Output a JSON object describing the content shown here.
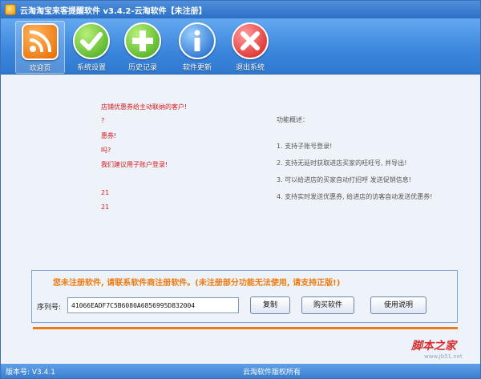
{
  "window": {
    "title": "云淘淘宝来客提醒软件 v3.4.2-云淘软件【未注册】"
  },
  "toolbar": {
    "items": [
      {
        "label": "欢迎页",
        "icon": "rss-icon",
        "active": true
      },
      {
        "label": "系统设置",
        "icon": "checkmark-icon"
      },
      {
        "label": "历史记录",
        "icon": "plus-icon"
      },
      {
        "label": "软件更新",
        "icon": "info-icon"
      },
      {
        "label": "退出系统",
        "icon": "close-icon"
      }
    ]
  },
  "log": {
    "lines": [
      "店铺优惠券给主动联纳的客户!",
      "?",
      "惠券!",
      "吗?",
      "我们建议用子账户登录!",
      "21",
      "21"
    ]
  },
  "features": {
    "heading": "功能概述：",
    "items": [
      "1. 支持子账号登录!",
      "2. 支持无延时获取进店买家的旺旺号, 并导出!",
      "3. 可以给进店的买家自动打招呼 发送促销信息!",
      "4. 支持实时发送优惠券, 给进店的访客自动发送优惠券!"
    ]
  },
  "register": {
    "notice": "您未注册软件, 请联系软件商注册软件。(未注册部分功能无法使用, 请支持正版!)",
    "serial_label": "序列号:",
    "serial_value": "41066EADF7C5B6080A6856995D832004",
    "copy_label": "复制",
    "buy_label": "购买软件",
    "help_label": "使用说明"
  },
  "status": {
    "version": "版本号: V3.4.1",
    "copyright": "云淘软件版权所有"
  },
  "watermark": {
    "text": "脚本之家",
    "url": "www.jb51.net"
  },
  "colors": {
    "titlebar": "#2c6fc6",
    "notice": "#ef7a10",
    "log": "#d81919",
    "accent_line": "#f07a13"
  }
}
